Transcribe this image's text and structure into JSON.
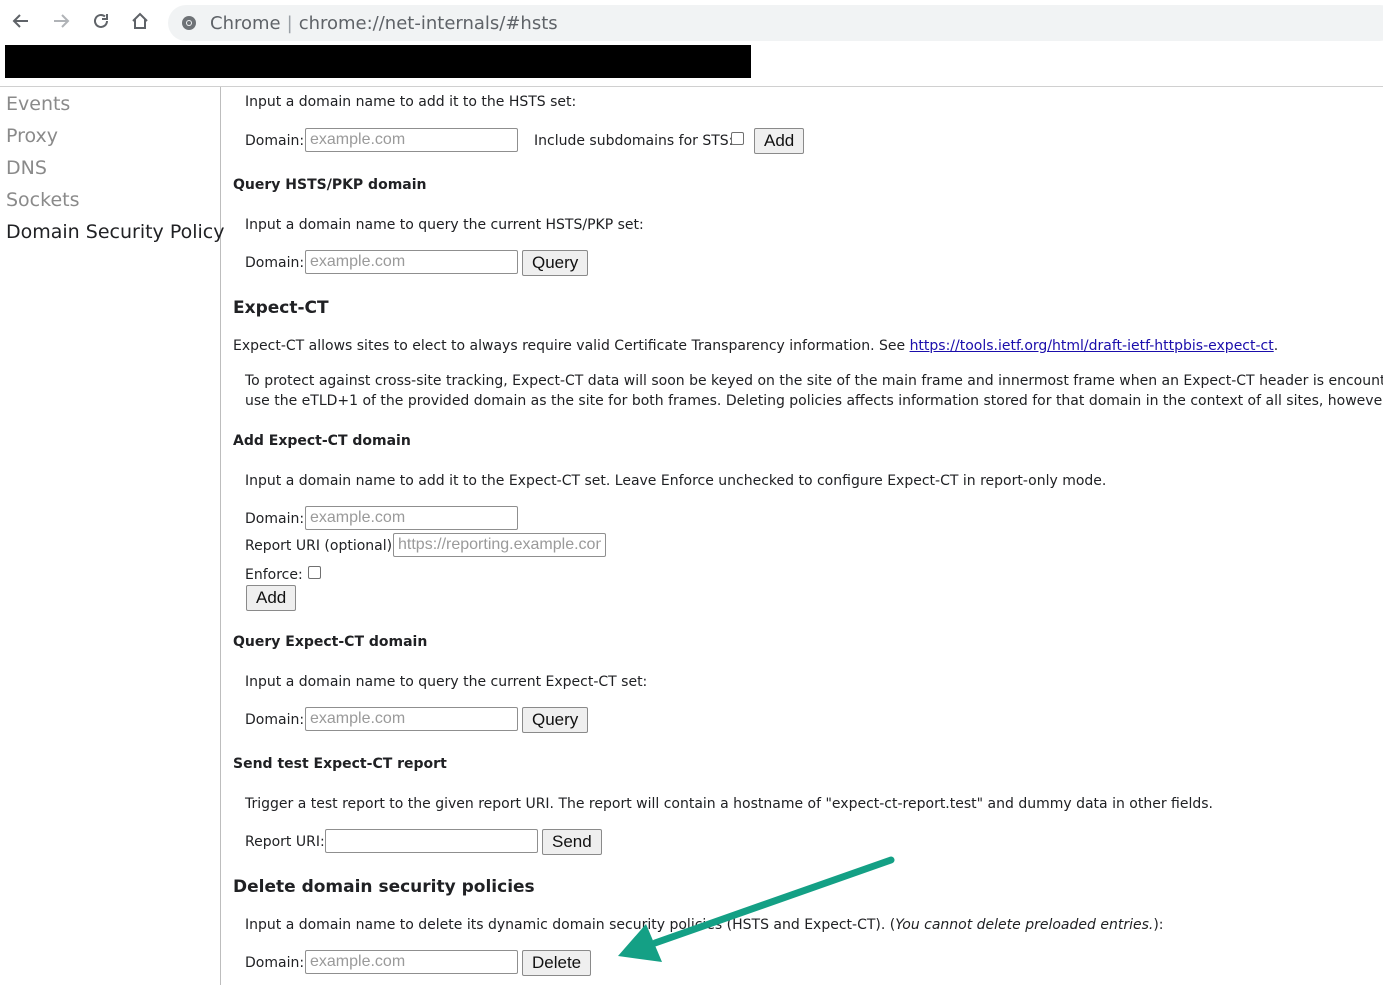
{
  "browser": {
    "chip": "Chrome",
    "separator": "|",
    "url": "chrome://net-internals/#hsts",
    "icons": [
      "back-arrow-icon",
      "forward-arrow-icon",
      "reload-icon",
      "home-icon",
      "chrome-logo-icon"
    ]
  },
  "sidebar": {
    "items": [
      {
        "label": "Events"
      },
      {
        "label": "Proxy"
      },
      {
        "label": "DNS"
      },
      {
        "label": "Sockets"
      },
      {
        "label": "Domain Security Policy"
      }
    ],
    "active_index": 4
  },
  "add_hsts": {
    "desc": "Input a domain name to add it to the HSTS set:",
    "domain_label": "Domain:",
    "placeholder": "example.com",
    "subdomains_label": "Include subdomains for STS:",
    "button": "Add"
  },
  "query_hsts": {
    "title": "Query HSTS/PKP domain",
    "desc": "Input a domain name to query the current HSTS/PKP set:",
    "domain_label": "Domain:",
    "placeholder": "example.com",
    "button": "Query"
  },
  "expect_ct": {
    "title": "Expect-CT",
    "intro": "Expect-CT allows sites to elect to always require valid Certificate Transparency information. See",
    "link": "https://tools.ietf.org/html/draft-ietf-httpbis-expect-ct",
    "intro_end": ".",
    "note_line1": "To protect against cross-site tracking, Expect-CT data will soon be keyed on the site of the main frame and innermost frame when an Expect-CT header is encountered. When",
    "note_line2": "use the eTLD+1 of the provided domain as the site for both frames. Deleting policies affects information stored for that domain in the context of all sites, however."
  },
  "add_expect_ct": {
    "title": "Add Expect-CT domain",
    "desc": "Input a domain name to add it to the Expect-CT set. Leave Enforce unchecked to configure Expect-CT in report-only mode.",
    "domain_label": "Domain:",
    "placeholder": "example.com",
    "report_label": "Report URI (optional):",
    "report_placeholder": "https://reporting.example.com",
    "enforce_label": "Enforce:",
    "button": "Add"
  },
  "query_expect_ct": {
    "title": "Query Expect-CT domain",
    "desc": "Input a domain name to query the current Expect-CT set:",
    "domain_label": "Domain:",
    "placeholder": "example.com",
    "button": "Query"
  },
  "test_report": {
    "title": "Send test Expect-CT report",
    "desc": "Trigger a test report to the given report URI. The report will contain a hostname of \"expect-ct-report.test\" and dummy data in other fields.",
    "uri_label": "Report URI:",
    "value": "",
    "button": "Send"
  },
  "delete_policies": {
    "title": "Delete domain security policies",
    "desc": "Input a domain name to delete its dynamic domain security policies (HSTS and Expect-CT). (",
    "desc_italic": "You cannot delete preloaded entries.",
    "desc_end": "):",
    "domain_label": "Domain:",
    "placeholder": "example.com",
    "button": "Delete"
  },
  "annotation": {
    "arrow_color": "#14a085"
  }
}
